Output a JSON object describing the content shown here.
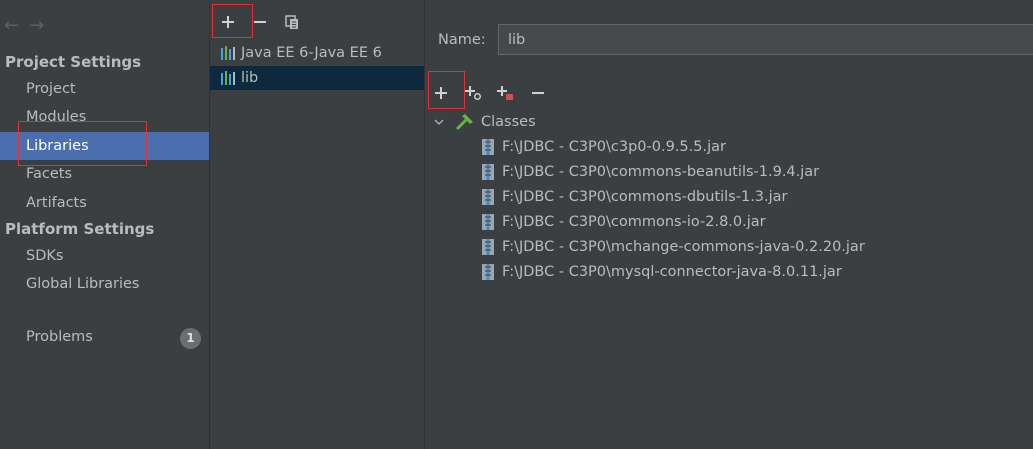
{
  "nav": {
    "back_arrow": "←",
    "forward_arrow": "→",
    "project_settings_title": "Project Settings",
    "project_items": [
      "Project",
      "Modules",
      "Libraries",
      "Facets",
      "Artifacts"
    ],
    "selected_item": "Libraries",
    "platform_settings_title": "Platform Settings",
    "platform_items": [
      "SDKs",
      "Global Libraries"
    ],
    "problems_label": "Problems",
    "problems_count": "1"
  },
  "libraries": {
    "toolbar_icons": [
      "add-icon",
      "remove-icon",
      "copy-icon"
    ],
    "items": [
      "Java EE 6-Java EE 6",
      "lib"
    ],
    "selected": "lib"
  },
  "detail": {
    "name_label": "Name:",
    "name_value": "lib",
    "toolbar_icons": [
      "add-icon",
      "add-specify-icon",
      "add-url-icon",
      "remove-icon"
    ],
    "classes_label": "Classes",
    "jars": [
      "F:\\JDBC - C3P0\\c3p0-0.9.5.5.jar",
      "F:\\JDBC - C3P0\\commons-beanutils-1.9.4.jar",
      "F:\\JDBC - C3P0\\commons-dbutils-1.3.jar",
      "F:\\JDBC - C3P0\\commons-io-2.8.0.jar",
      "F:\\JDBC - C3P0\\mchange-commons-java-0.2.20.jar",
      "F:\\JDBC - C3P0\\mysql-connector-java-8.0.11.jar"
    ]
  },
  "colors": {
    "selection_blue": "#4b6eaf",
    "dark_selection": "#0d293e",
    "highlight_red": "#e0303a",
    "classes_green": "#62b543"
  }
}
